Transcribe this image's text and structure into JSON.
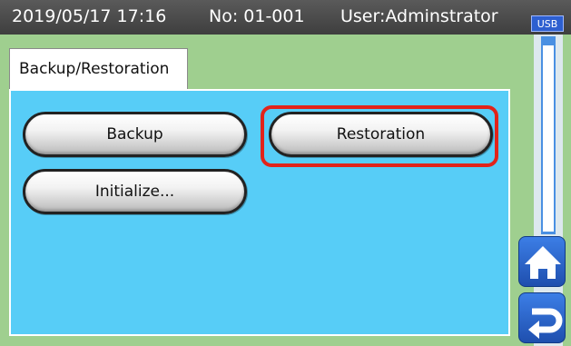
{
  "header": {
    "datetime": "2019/05/17 17:16",
    "number": "No: 01-001",
    "user": "User:Adminstrator",
    "usb_label": "USB"
  },
  "tab": {
    "label": "Backup/Restoration"
  },
  "buttons": {
    "backup": "Backup",
    "restoration": "Restoration",
    "initialize": "Initialize..."
  },
  "icons": {
    "home": "home-icon",
    "return": "return-icon"
  },
  "colors": {
    "panel": "#57cdf7",
    "header": "#4a4a4a",
    "background": "#9fcf8f",
    "highlight": "#e2231a",
    "nav": "#2c66cf"
  }
}
